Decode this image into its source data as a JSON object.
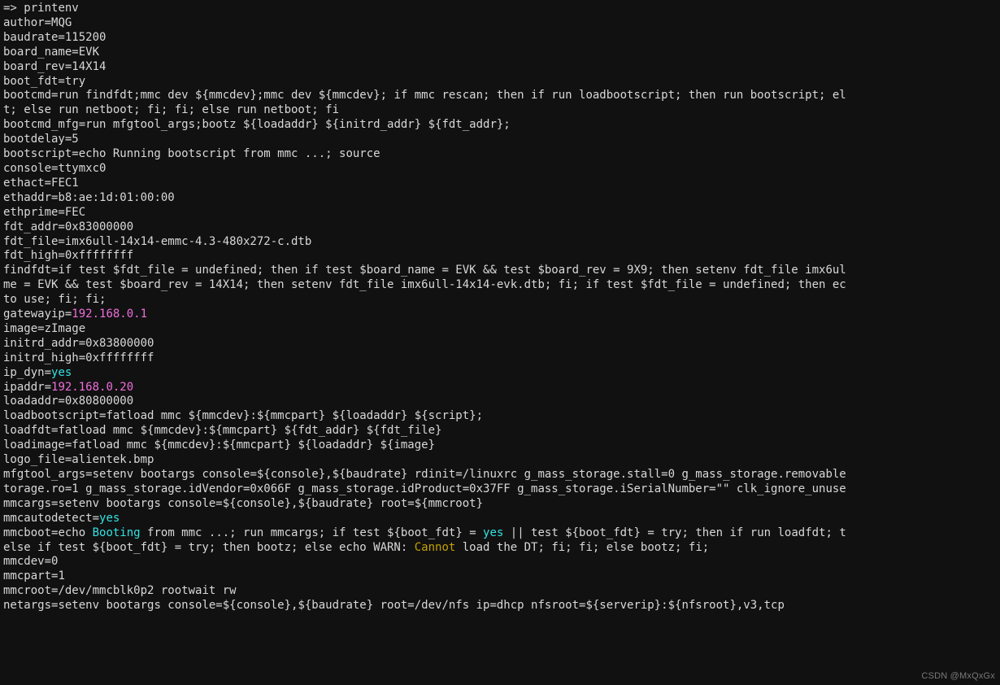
{
  "prompt": "=>",
  "command": "printenv",
  "env": {
    "author": "MQG",
    "baudrate": "115200",
    "board_name": "EVK",
    "board_rev": "14X14",
    "boot_fdt": "try",
    "bootcmd_l1": "run findfdt;mmc dev ${mmcdev};mmc dev ${mmcdev}; if mmc rescan; then if run loadbootscript; then run bootscript; el",
    "bootcmd_l2": "t; else run netboot; fi; fi; else run netboot; fi",
    "bootcmd_mfg": "run mfgtool_args;bootz ${loadaddr} ${initrd_addr} ${fdt_addr};",
    "bootdelay": "5",
    "bootscript": "echo Running bootscript from mmc ...; source",
    "console": "ttymxc0",
    "ethact": "FEC1",
    "ethaddr": "b8:ae:1d:01:00:00",
    "ethprime": "FEC",
    "fdt_addr": "0x83000000",
    "fdt_file": "imx6ull-14x14-emmc-4.3-480x272-c.dtb",
    "fdt_high": "0xffffffff",
    "findfdt_l1": "if test $fdt_file = undefined; then if test $board_name = EVK && test $board_rev = 9X9; then setenv fdt_file imx6ul",
    "findfdt_l2": "me = EVK && test $board_rev = 14X14; then setenv fdt_file imx6ull-14x14-evk.dtb; fi; if test $fdt_file = undefined; then ec",
    "findfdt_l3": "to use; fi; fi;",
    "gatewayip": "192.168.0.1",
    "image": "zImage",
    "initrd_addr": "0x83800000",
    "initrd_high": "0xffffffff",
    "ip_dyn": "yes",
    "ipaddr": "192.168.0.20",
    "loadaddr": "0x80800000",
    "loadbootscript": "fatload mmc ${mmcdev}:${mmcpart} ${loadaddr} ${script};",
    "loadfdt": "fatload mmc ${mmcdev}:${mmcpart} ${fdt_addr} ${fdt_file}",
    "loadimage": "fatload mmc ${mmcdev}:${mmcpart} ${loadaddr} ${image}",
    "logo_file": "alientek.bmp",
    "mfgtool_args_l1": "setenv bootargs console=${console},${baudrate} rdinit=/linuxrc g_mass_storage.stall=0 g_mass_storage.removable",
    "mfgtool_args_l2": "torage.ro=1 g_mass_storage.idVendor=0x066F g_mass_storage.idProduct=0x37FF g_mass_storage.iSerialNumber=\"\" clk_ignore_unuse",
    "mmcargs": "setenv bootargs console=${console},${baudrate} root=${mmcroot}",
    "mmcautodetect": "yes",
    "mmcboot_pre": "echo ",
    "mmcboot_boot": "Booting",
    "mmcboot_mid1": " from mmc ...; run mmcargs; if test ${boot_fdt} = ",
    "mmcboot_yes": "yes",
    "mmcboot_mid2": " || test ${boot_fdt} = try; then if run loadfdt; t",
    "mmcboot_l2a": " else if test ${boot_fdt} = try; then bootz; else echo WARN: ",
    "mmcboot_cannot": "Cannot",
    "mmcboot_l2b": " load the DT; fi; fi; else bootz; fi;",
    "mmcdev": "0",
    "mmcpart": "1",
    "mmcroot": "/dev/mmcblk0p2 rootwait rw",
    "netargs": "setenv bootargs console=${console},${baudrate} root=/dev/nfs ip=dhcp nfsroot=${serverip}:${nfsroot},v3,tcp"
  },
  "labels": {
    "author": "author=",
    "baudrate": "baudrate=",
    "board_name": "board_name=",
    "board_rev": "board_rev=",
    "boot_fdt": "boot_fdt=",
    "bootcmd": "bootcmd=",
    "bootcmd_mfg": "bootcmd_mfg=",
    "bootdelay": "bootdelay=",
    "bootscript": "bootscript=",
    "console": "console=",
    "ethact": "ethact=",
    "ethaddr": "ethaddr=",
    "ethprime": "ethprime=",
    "fdt_addr": "fdt_addr=",
    "fdt_file": "fdt_file=",
    "fdt_high": "fdt_high=",
    "findfdt": "findfdt=",
    "gatewayip": "gatewayip=",
    "image": "image=",
    "initrd_addr": "initrd_addr=",
    "initrd_high": "initrd_high=",
    "ip_dyn": "ip_dyn=",
    "ipaddr": "ipaddr=",
    "loadaddr": "loadaddr=",
    "loadbootscript": "loadbootscript=",
    "loadfdt": "loadfdt=",
    "loadimage": "loadimage=",
    "logo_file": "logo_file=",
    "mfgtool_args": "mfgtool_args=",
    "mmcargs": "mmcargs=",
    "mmcautodetect": "mmcautodetect=",
    "mmcboot": "mmcboot=",
    "mmcdev": "mmcdev=",
    "mmcpart": "mmcpart=",
    "mmcroot": "mmcroot=",
    "netargs": "netargs="
  },
  "watermark": "CSDN @MxQxGx"
}
